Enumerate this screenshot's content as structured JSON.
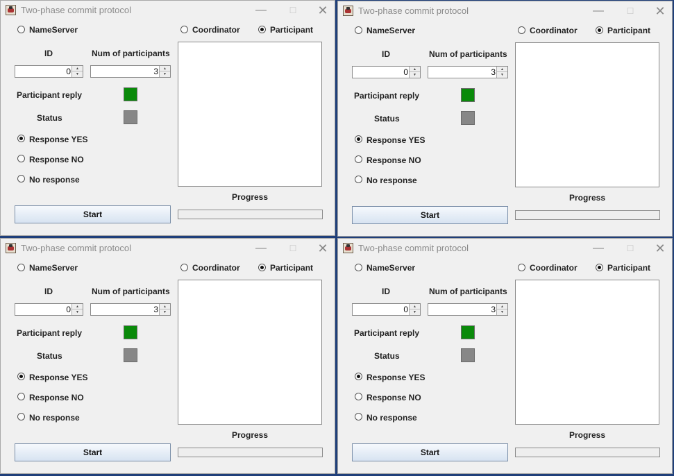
{
  "windows": [
    {
      "title": "Two-phase commit protocol",
      "role_options": {
        "nameserver": "NameServer",
        "coordinator": "Coordinator",
        "participant": "Participant",
        "selected": "Participant"
      },
      "id_label": "ID",
      "id_value": "0",
      "num_label": "Num of participants",
      "num_value": "3",
      "reply_label": "Participant reply",
      "reply_color": "#0a8a0a",
      "status_label": "Status",
      "status_color": "#878787",
      "responses": {
        "yes": "Response YES",
        "no": "Response NO",
        "none": "No response",
        "selected": "Response YES"
      },
      "progress_label": "Progress",
      "progress_value": 0,
      "start_label": "Start"
    },
    {
      "title": "Two-phase commit protocol",
      "role_options": {
        "nameserver": "NameServer",
        "coordinator": "Coordinator",
        "participant": "Participant",
        "selected": "Participant"
      },
      "id_label": "ID",
      "id_value": "0",
      "num_label": "Num of participants",
      "num_value": "3",
      "reply_label": "Participant reply",
      "reply_color": "#0a8a0a",
      "status_label": "Status",
      "status_color": "#878787",
      "responses": {
        "yes": "Response YES",
        "no": "Response NO",
        "none": "No response",
        "selected": "Response YES"
      },
      "progress_label": "Progress",
      "progress_value": 0,
      "start_label": "Start"
    },
    {
      "title": "Two-phase commit protocol",
      "role_options": {
        "nameserver": "NameServer",
        "coordinator": "Coordinator",
        "participant": "Participant",
        "selected": "Participant"
      },
      "id_label": "ID",
      "id_value": "0",
      "num_label": "Num of participants",
      "num_value": "3",
      "reply_label": "Participant reply",
      "reply_color": "#0a8a0a",
      "status_label": "Status",
      "status_color": "#878787",
      "responses": {
        "yes": "Response YES",
        "no": "Response NO",
        "none": "No response",
        "selected": "Response YES"
      },
      "progress_label": "Progress",
      "progress_value": 0,
      "start_label": "Start"
    },
    {
      "title": "Two-phase commit protocol",
      "role_options": {
        "nameserver": "NameServer",
        "coordinator": "Coordinator",
        "participant": "Participant",
        "selected": "Participant"
      },
      "id_label": "ID",
      "id_value": "0",
      "num_label": "Num of participants",
      "num_value": "3",
      "reply_label": "Participant reply",
      "reply_color": "#0a8a0a",
      "status_label": "Status",
      "status_color": "#878787",
      "responses": {
        "yes": "Response YES",
        "no": "Response NO",
        "none": "No response",
        "selected": "Response YES"
      },
      "progress_label": "Progress",
      "progress_value": 0,
      "start_label": "Start"
    }
  ],
  "icons": [
    "app-java-icon",
    "minimize-icon",
    "maximize-icon",
    "close-icon"
  ]
}
